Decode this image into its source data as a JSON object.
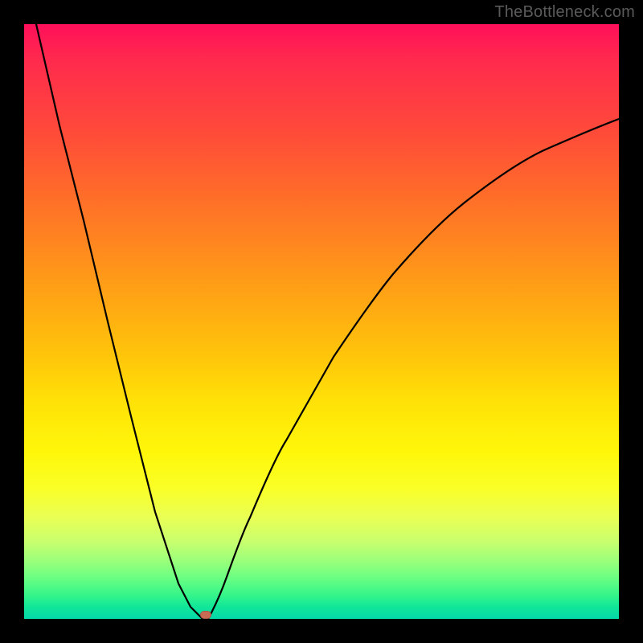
{
  "attribution": "TheBottleneck.com",
  "colors": {
    "frame": "#000000",
    "gradient_top": "#ff0f5a",
    "gradient_mid": "#ffe307",
    "gradient_bottom": "#05d8a8",
    "curve": "#000000",
    "marker": "#c96a55"
  },
  "chart_data": {
    "type": "line",
    "title": "",
    "xlabel": "",
    "ylabel": "",
    "xlim": [
      0,
      100
    ],
    "ylim": [
      0,
      100
    ],
    "grid": false,
    "legend": false,
    "series": [
      {
        "name": "bottleneck-curve",
        "x": [
          2,
          6,
          10,
          14,
          18,
          22,
          26,
          28,
          30,
          31,
          32,
          34,
          38,
          44,
          52,
          62,
          74,
          88,
          100
        ],
        "values": [
          100,
          83,
          67,
          50,
          34,
          18,
          6,
          2,
          0,
          0,
          2,
          7,
          17,
          30,
          44,
          58,
          70,
          79,
          84
        ]
      }
    ],
    "annotations": [
      {
        "name": "minimum-point",
        "x": 30,
        "y": 0
      }
    ]
  }
}
